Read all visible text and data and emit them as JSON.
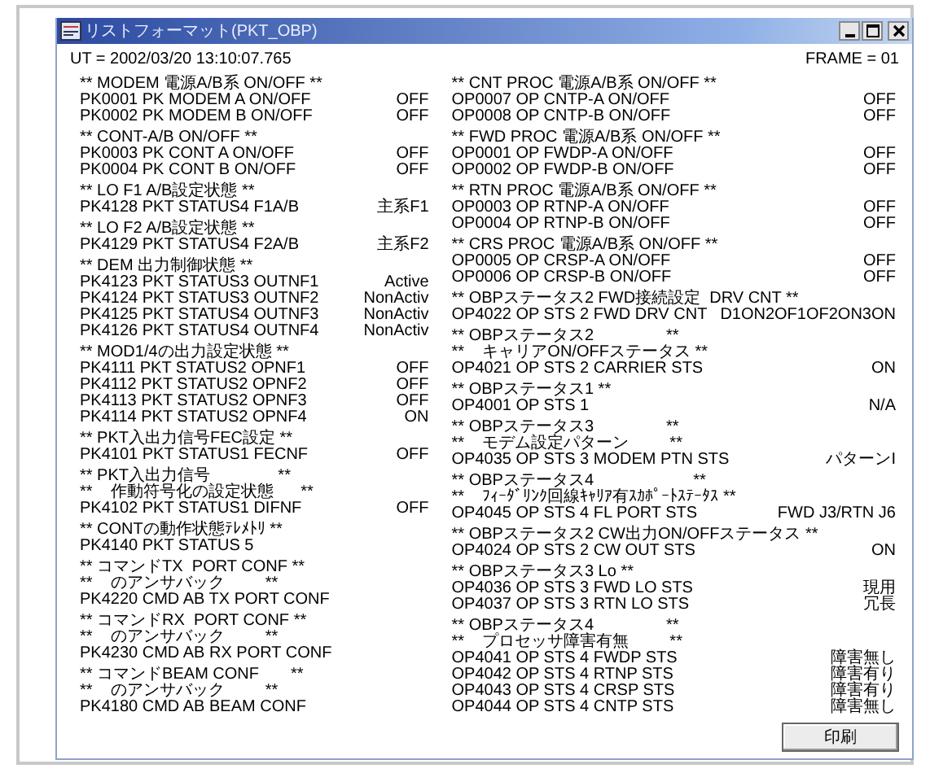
{
  "window": {
    "title": "リストフォーマット(PKT_OBP)"
  },
  "header": {
    "time": "UT = 2002/03/20 13:10:07.765",
    "frame": "FRAME = 01"
  },
  "columns": [
    [
      {
        "heading": [
          "** MODEM 電源A/B系 ON/OFF **"
        ],
        "items": [
          {
            "label": "PK0001 PK MODEM A ON/OFF",
            "value": "OFF"
          },
          {
            "label": "PK0002 PK MODEM B ON/OFF",
            "value": "OFF"
          }
        ]
      },
      {
        "heading": [
          "** CONT-A/B ON/OFF **"
        ],
        "items": [
          {
            "label": "PK0003 PK CONT A ON/OFF",
            "value": "OFF"
          },
          {
            "label": "PK0004 PK CONT B ON/OFF",
            "value": "OFF"
          }
        ]
      },
      {
        "heading": [
          "** LO F1 A/B設定状態 **"
        ],
        "items": [
          {
            "label": "PK4128 PKT STATUS4 F1A/B",
            "value": "主系F1"
          }
        ]
      },
      {
        "heading": [
          "** LO F2 A/B設定状態 **"
        ],
        "items": [
          {
            "label": "PK4129 PKT STATUS4 F2A/B",
            "value": "主系F2"
          }
        ]
      },
      {
        "heading": [
          "** DEM 出力制御状態 **"
        ],
        "items": [
          {
            "label": "PK4123 PKT STATUS3 OUTNF1",
            "value": "Active"
          },
          {
            "label": "PK4124 PKT STATUS3 OUTNF2",
            "value": "NonActiv"
          },
          {
            "label": "PK4125 PKT STATUS4 OUTNF3",
            "value": "NonActiv"
          },
          {
            "label": "PK4126 PKT STATUS4 OUTNF4",
            "value": "NonActiv"
          }
        ]
      },
      {
        "heading": [
          "** MOD1/4の出力設定状態 **"
        ],
        "items": [
          {
            "label": "PK4111 PKT STATUS2 OPNF1",
            "value": "OFF"
          },
          {
            "label": "PK4112 PKT STATUS2 OPNF2",
            "value": "OFF"
          },
          {
            "label": "PK4113 PKT STATUS2 OPNF3",
            "value": "OFF"
          },
          {
            "label": "PK4114 PKT STATUS2 OPNF4",
            "value": "ON"
          }
        ]
      },
      {
        "heading": [
          "** PKT入出力信号FEC設定 **"
        ],
        "items": [
          {
            "label": "PK4101 PKT STATUS1 FECNF",
            "value": "OFF"
          }
        ]
      },
      {
        "heading": [
          "** PKT入出力信号               **",
          "**    作動符号化の設定状態      **"
        ],
        "items": [
          {
            "label": "PK4102 PKT STATUS1 DIFNF",
            "value": "OFF"
          }
        ]
      },
      {
        "heading": [
          "** CONTの動作状態ﾃﾚﾒﾄﾘ **"
        ],
        "items": [
          {
            "label": "PK4140 PKT STATUS 5"
          }
        ]
      },
      {
        "heading": [
          "** コマンドTX  PORT CONF **",
          "**    のアンサバック         **"
        ],
        "items": [
          {
            "label": "PK4220 CMD AB TX PORT CONF"
          }
        ]
      },
      {
        "heading": [
          "** コマンドRX  PORT CONF **",
          "**    のアンサバック         **"
        ],
        "items": [
          {
            "label": "PK4230 CMD AB RX PORT CONF"
          }
        ]
      },
      {
        "heading": [
          "** コマンドBEAM CONF       **",
          "**    のアンサバック         **"
        ],
        "items": [
          {
            "label": "PK4180 CMD AB BEAM CONF"
          }
        ]
      }
    ],
    [
      {
        "heading": [
          "** CNT PROC 電源A/B系 ON/OFF **"
        ],
        "items": [
          {
            "label": "OP0007 OP CNTP-A ON/OFF",
            "value": "OFF"
          },
          {
            "label": "OP0008 OP CNTP-B ON/OFF",
            "value": "OFF"
          }
        ]
      },
      {
        "heading": [
          "** FWD PROC 電源A/B系 ON/OFF **"
        ],
        "items": [
          {
            "label": "OP0001 OP FWDP-A ON/OFF",
            "value": "OFF"
          },
          {
            "label": "OP0002 OP FWDP-B ON/OFF",
            "value": "OFF"
          }
        ]
      },
      {
        "heading": [
          "** RTN PROC 電源A/B系 ON/OFF **"
        ],
        "items": [
          {
            "label": "OP0003 OP RTNP-A ON/OFF",
            "value": "OFF"
          },
          {
            "label": "OP0004 OP RTNP-B ON/OFF",
            "value": "OFF"
          }
        ]
      },
      {
        "heading": [
          "** CRS PROC 電源A/B系 ON/OFF **"
        ],
        "items": [
          {
            "label": "OP0005 OP CRSP-A ON/OFF",
            "value": "OFF"
          },
          {
            "label": "OP0006 OP CRSP-B ON/OFF",
            "value": "OFF"
          }
        ]
      },
      {
        "heading": [
          "** OBPステータス2 FWD接続設定  DRV CNT **"
        ],
        "items": [
          {
            "label": "OP4022 OP STS 2 FWD DRV CNT",
            "value": "D1ON2OF1OF2ON3ON"
          }
        ]
      },
      {
        "heading": [
          "** OBPステータス2                **",
          "**    キャリアON/OFFステータス **"
        ],
        "items": [
          {
            "label": "OP4021 OP STS 2 CARRIER STS",
            "value": "ON"
          }
        ]
      },
      {
        "heading": [
          "** OBPステータス1 **"
        ],
        "items": [
          {
            "label": "OP4001 OP STS 1",
            "value": "N/A"
          }
        ]
      },
      {
        "heading": [
          "** OBPステータス3                **",
          "**    モデム設定パターン         **"
        ],
        "items": [
          {
            "label": "OP4035 OP STS 3 MODEM PTN STS",
            "value": "パターンI"
          }
        ]
      },
      {
        "heading": [
          "** OBPステータス4                      **",
          "**    ﾌｨｰﾀﾞﾘﾝｸ回線ｷｬﾘｱ有ｽｶﾎﾟｰﾄｽﾃｰﾀｽ **"
        ],
        "items": [
          {
            "label": "OP4045 OP STS 4 FL PORT STS",
            "value": "FWD J3/RTN J6"
          }
        ]
      },
      {
        "heading": [
          "** OBPステータス2 CW出力ON/OFFステータス **"
        ],
        "items": [
          {
            "label": "OP4024 OP STS 2 CW OUT STS",
            "value": "ON"
          }
        ]
      },
      {
        "heading": [
          "** OBPステータス3 Lo **"
        ],
        "items": [
          {
            "label": "OP4036 OP STS 3 FWD LO STS",
            "value": "現用"
          },
          {
            "label": "OP4037 OP STS 3 RTN LO STS",
            "value": "冗長"
          }
        ]
      },
      {
        "heading": [
          "** OBPステータス4                **",
          "**    プロセッサ障害有無         **"
        ],
        "items": [
          {
            "label": "OP4041 OP STS 4 FWDP STS",
            "value": "障害無し"
          },
          {
            "label": "OP4042 OP STS 4 RTNP STS",
            "value": "障害有り"
          },
          {
            "label": "OP4043 OP STS 4 CRSP STS",
            "value": "障害有り"
          },
          {
            "label": "OP4044 OP STS 4 CNTP STS",
            "value": "障害無し"
          }
        ]
      }
    ]
  ],
  "buttons": [
    "印刷"
  ]
}
